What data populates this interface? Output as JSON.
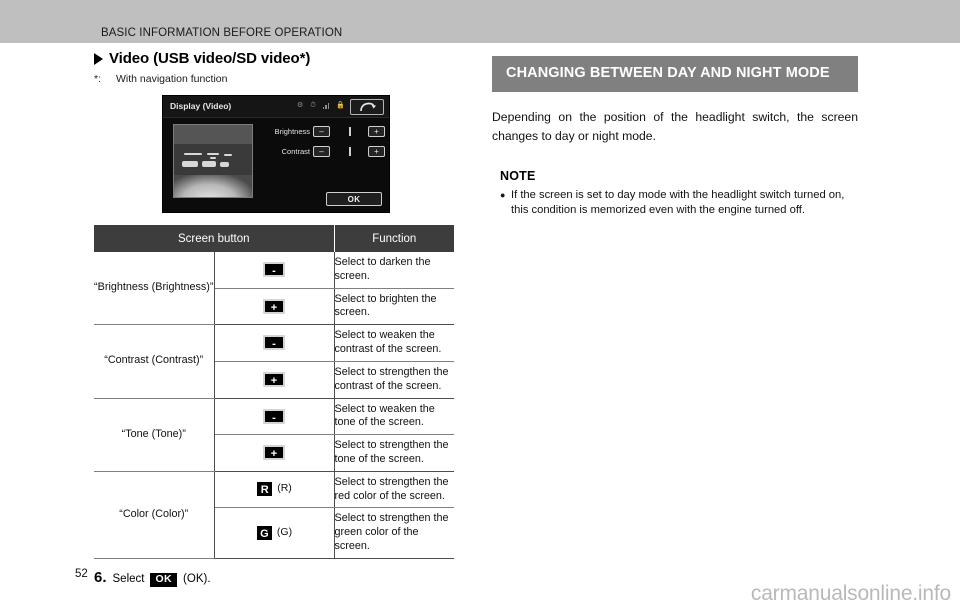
{
  "header": {
    "running_head": "BASIC INFORMATION BEFORE OPERATION"
  },
  "left": {
    "subheading": "Video (USB video/SD video*)",
    "footnote_mark": "*:",
    "footnote_text": "With navigation function",
    "device_screen": {
      "title": "Display (Video)",
      "status_icons": [
        "gear-icon",
        "clock-icon",
        "signal-bars-icon",
        "lock-icon"
      ],
      "back_button": "back-arrow-icon",
      "controls": [
        {
          "label": "Brightness",
          "minus": "–",
          "plus": "+"
        },
        {
          "label": "Contrast",
          "minus": "–",
          "plus": "+"
        }
      ],
      "ok_label": "OK"
    },
    "table": {
      "columns": [
        "Screen button",
        "Function"
      ],
      "groups": [
        {
          "name": "“Brightness (Brightness)”",
          "rows": [
            {
              "key": "-",
              "key_type": "minus",
              "function": "Select to darken the screen."
            },
            {
              "key": "+",
              "key_type": "plus",
              "function": "Select to brighten the screen."
            }
          ]
        },
        {
          "name": "“Contrast (Contrast)”",
          "rows": [
            {
              "key": "-",
              "key_type": "minus",
              "function": "Select to weaken the contrast of the screen."
            },
            {
              "key": "+",
              "key_type": "plus",
              "function": "Select to strengthen the contrast of the screen."
            }
          ]
        },
        {
          "name": "“Tone (Tone)”",
          "rows": [
            {
              "key": "-",
              "key_type": "minus",
              "function": "Select to weaken the tone of the screen."
            },
            {
              "key": "+",
              "key_type": "plus",
              "function": "Select to strengthen the tone of the screen."
            }
          ]
        },
        {
          "name": "“Color (Color)”",
          "rows": [
            {
              "key": "R",
              "key_type": "letter",
              "key_suffix": "(R)",
              "function": "Select to strengthen the red color of the screen."
            },
            {
              "key": "G",
              "key_type": "letter",
              "key_suffix": "(G)",
              "function": "Select to strengthen the green color of the screen."
            }
          ]
        }
      ]
    },
    "step": {
      "number": "6.",
      "text_before": "Select",
      "key": "OK",
      "text_after": "(OK)."
    },
    "page_number": "52"
  },
  "right": {
    "section_title": "CHANGING BETWEEN DAY AND NIGHT MODE",
    "paragraph": "Depending on the position of the headlight switch, the screen changes to day or night mode.",
    "note": {
      "title": "NOTE",
      "bullet": "●",
      "items": [
        "If the screen is set to day mode with the headlight switch turned on, this condition is memorized even with the engine turned off."
      ]
    }
  },
  "watermark": "carmanualsonline.info",
  "colors": {
    "running_head_bar": "#bfbfbf",
    "table_header": "#3d3d3d",
    "section_bar": "#808080",
    "key_box": "#000000",
    "watermark": "#b9b9b9"
  }
}
